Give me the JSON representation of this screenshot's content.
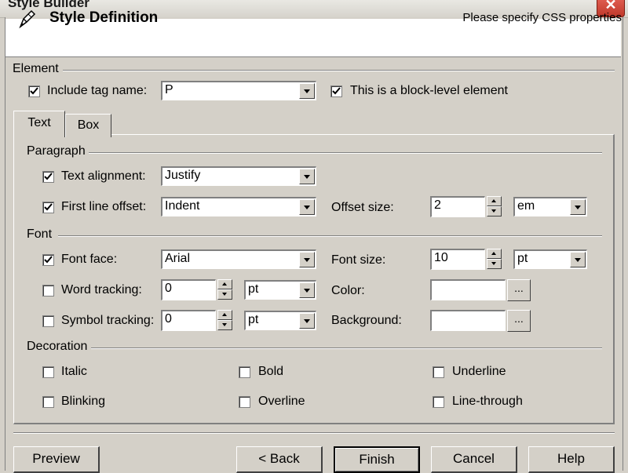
{
  "window": {
    "title": "Style Builder",
    "close_label": "✕"
  },
  "header": {
    "title": "Style Definition",
    "hint": "Please specify CSS properties"
  },
  "element": {
    "group_label": "Element",
    "include_tag": {
      "label": "Include tag name:",
      "checked": true
    },
    "tag_value": "P",
    "block_level": {
      "label": "This is a block-level element",
      "checked": true
    }
  },
  "tabs": [
    {
      "label": "Text",
      "active": true
    },
    {
      "label": "Box",
      "active": false
    }
  ],
  "paragraph": {
    "group_label": "Paragraph",
    "text_alignment": {
      "label": "Text alignment:",
      "checked": true,
      "value": "Justify"
    },
    "first_line_offset": {
      "label": "First line offset:",
      "checked": true,
      "value": "Indent"
    },
    "offset_size": {
      "label": "Offset size:",
      "value": "2",
      "unit": "em"
    }
  },
  "font": {
    "group_label": "Font",
    "font_face": {
      "label": "Font face:",
      "checked": true,
      "value": "Arial"
    },
    "font_size": {
      "label": "Font size:",
      "value": "10",
      "unit": "pt"
    },
    "word_tracking": {
      "label": "Word tracking:",
      "checked": false,
      "value": "0",
      "unit": "pt"
    },
    "symbol_tracking": {
      "label": "Symbol tracking:",
      "checked": false,
      "value": "0",
      "unit": "pt"
    },
    "color": {
      "label": "Color:",
      "value": "",
      "button": "..."
    },
    "background": {
      "label": "Background:",
      "value": "",
      "button": "..."
    }
  },
  "decoration": {
    "group_label": "Decoration",
    "italic": "Italic",
    "bold": "Bold",
    "underline": "Underline",
    "blinking": "Blinking",
    "overline": "Overline",
    "line_through": "Line-through"
  },
  "buttons": {
    "preview": "Preview",
    "back": "< Back",
    "finish": "Finish",
    "cancel": "Cancel",
    "help": "Help"
  }
}
